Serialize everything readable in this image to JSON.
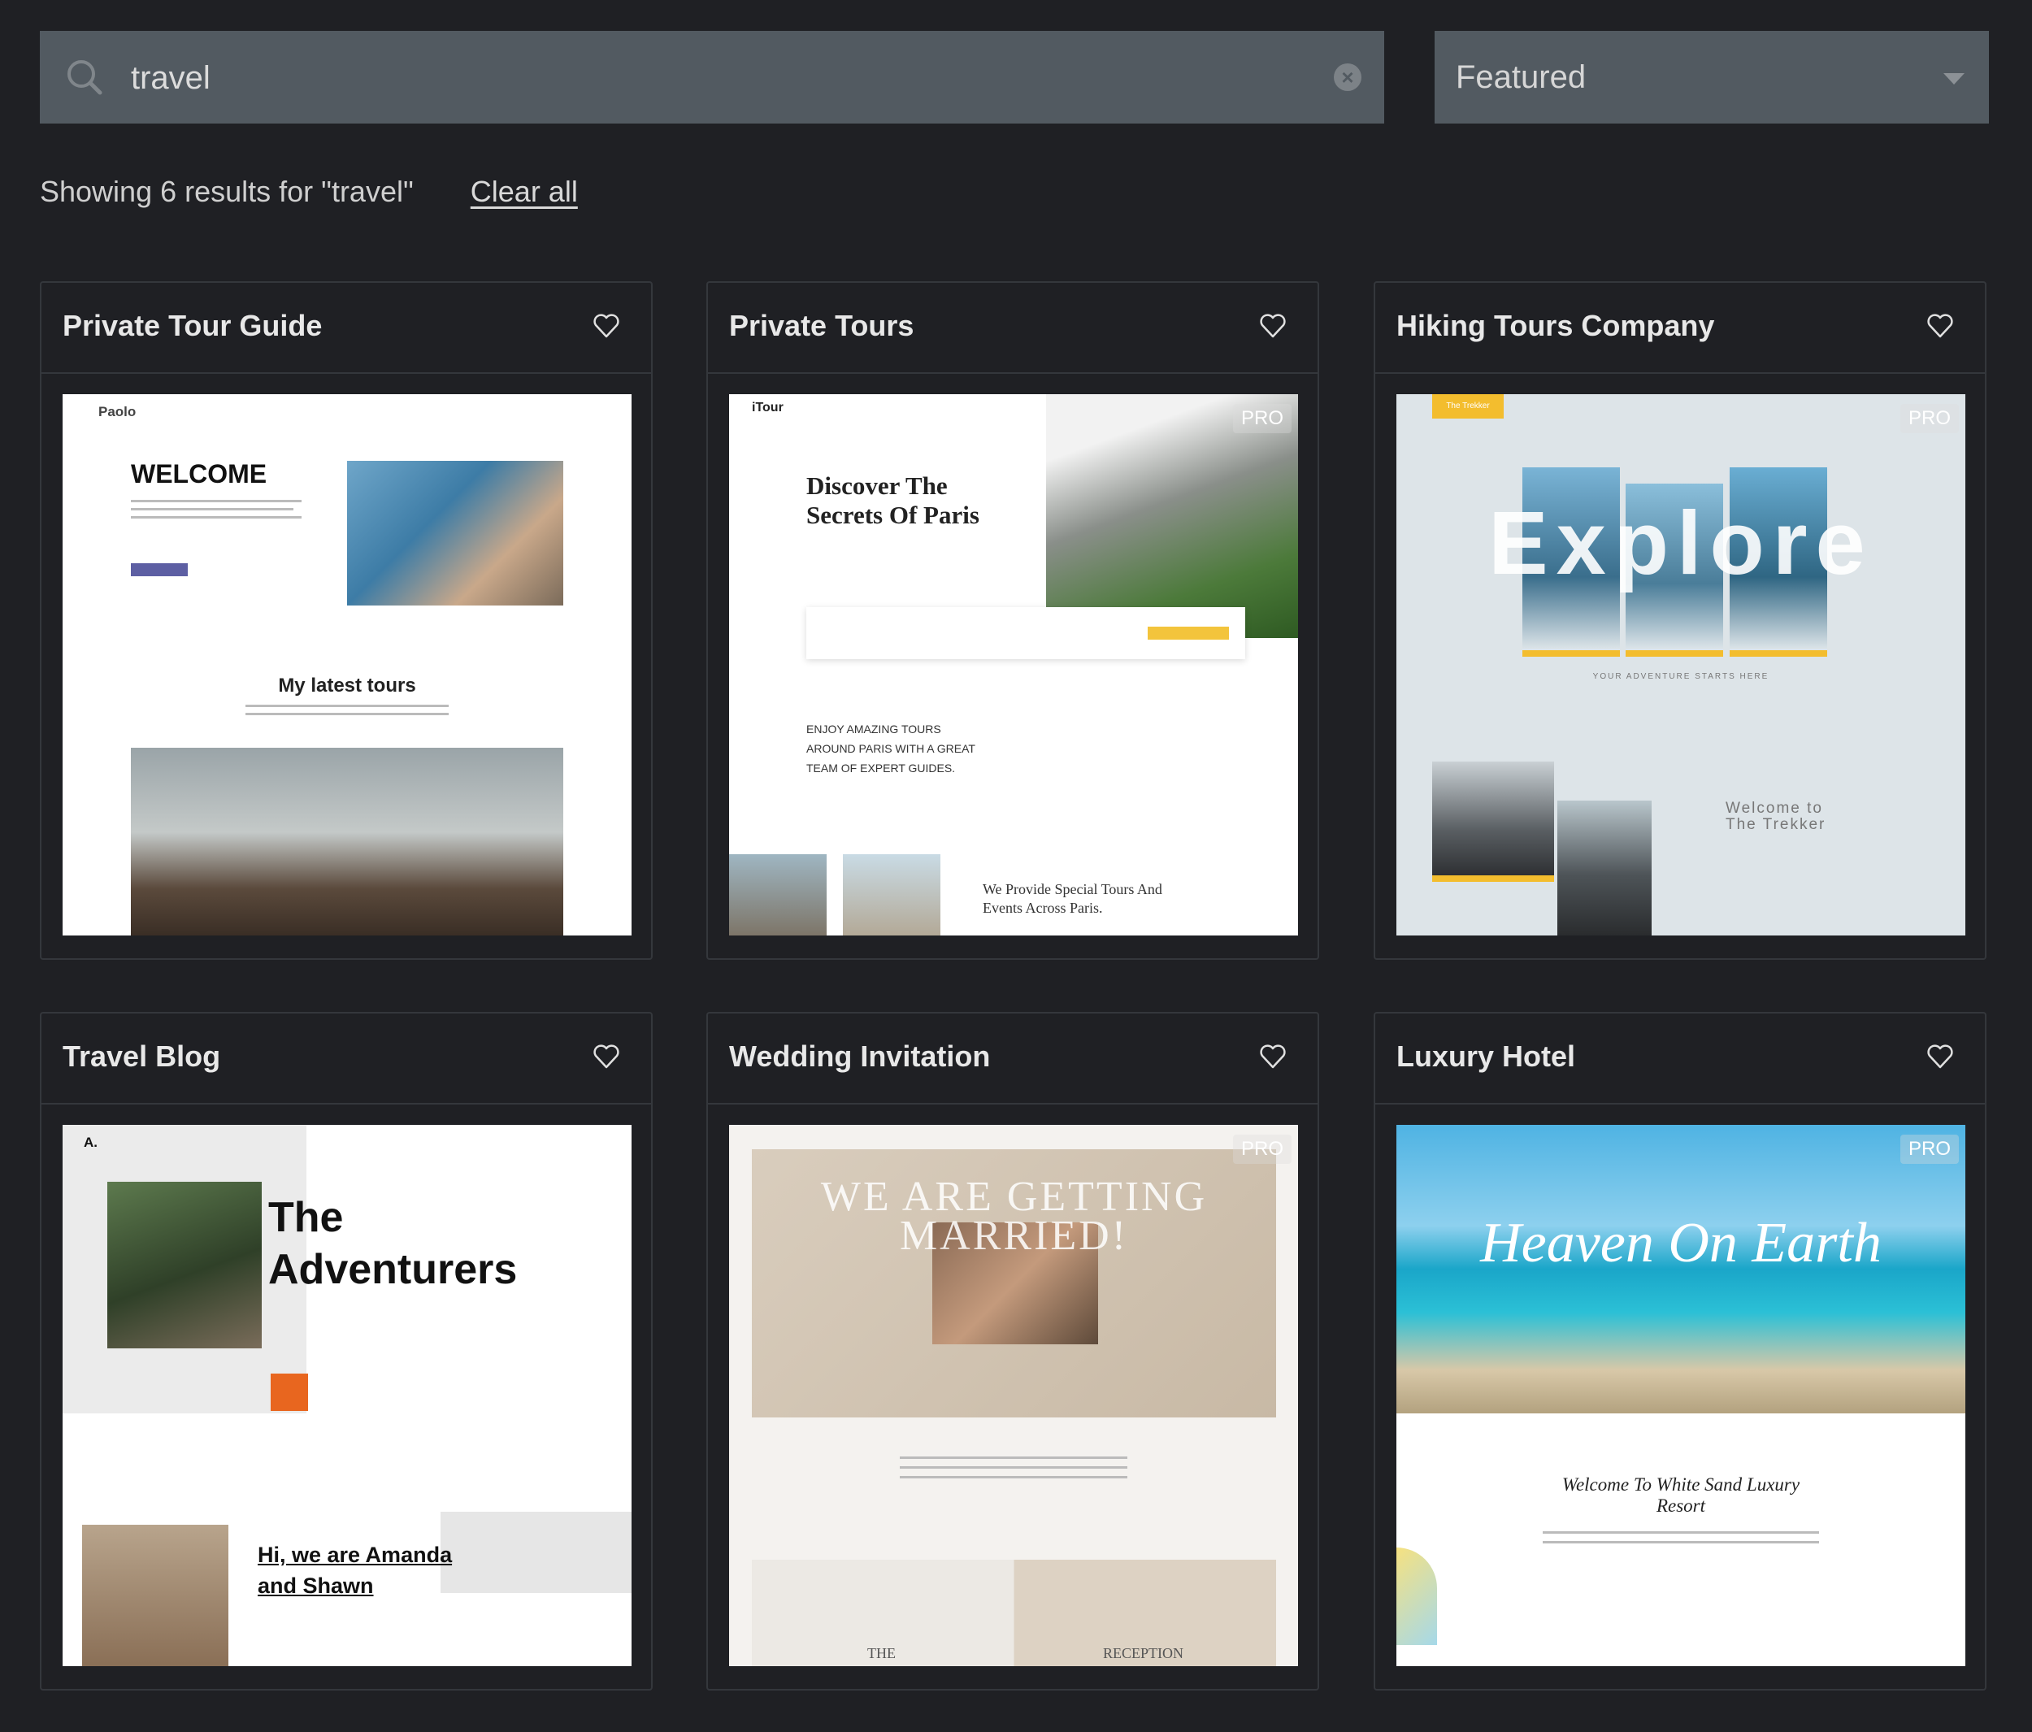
{
  "search": {
    "value": "travel",
    "icon": "search-icon",
    "clear_icon": "clear-circle-x-icon"
  },
  "sort": {
    "selected": "Featured",
    "icon": "caret-down-icon"
  },
  "results": {
    "text": "Showing 6 results for \"travel\"",
    "clear_all": "Clear all"
  },
  "colors": {
    "background": "#1f2024",
    "input_bg": "#525a61",
    "card_border": "#34373c"
  },
  "cards": [
    {
      "title": "Private Tour Guide",
      "pro": false,
      "preview": {
        "brand": "Paolo",
        "headline": "WELCOME",
        "section": "My latest tours"
      }
    },
    {
      "title": "Private Tours",
      "pro": true,
      "pro_label": "PRO",
      "preview": {
        "brand": "iTour",
        "headline": "Discover The Secrets Of Paris",
        "tagline": "ENJOY AMAZING TOURS AROUND PARIS WITH A GREAT TEAM OF EXPERT GUIDES.",
        "footer": "We Provide Special Tours And Events Across Paris."
      }
    },
    {
      "title": "Hiking Tours Company",
      "pro": true,
      "pro_label": "PRO",
      "preview": {
        "brand": "The Trekker",
        "headline": "Explore",
        "tagline": "YOUR ADVENTURE STARTS HERE",
        "section": "Welcome to The Trekker"
      }
    },
    {
      "title": "Travel Blog",
      "pro": false,
      "preview": {
        "brand": "A.",
        "headline": "The Adventurers",
        "section": "Hi, we are Amanda and Shawn"
      }
    },
    {
      "title": "Wedding Invitation",
      "pro": true,
      "pro_label": "PRO",
      "preview": {
        "headline": "WE ARE GETTING MARRIED!",
        "left": "THE",
        "right": "RECEPTION"
      }
    },
    {
      "title": "Luxury Hotel",
      "pro": true,
      "pro_label": "PRO",
      "preview": {
        "headline": "Heaven On Earth",
        "section": "Welcome To White Sand Luxury Resort"
      }
    }
  ]
}
